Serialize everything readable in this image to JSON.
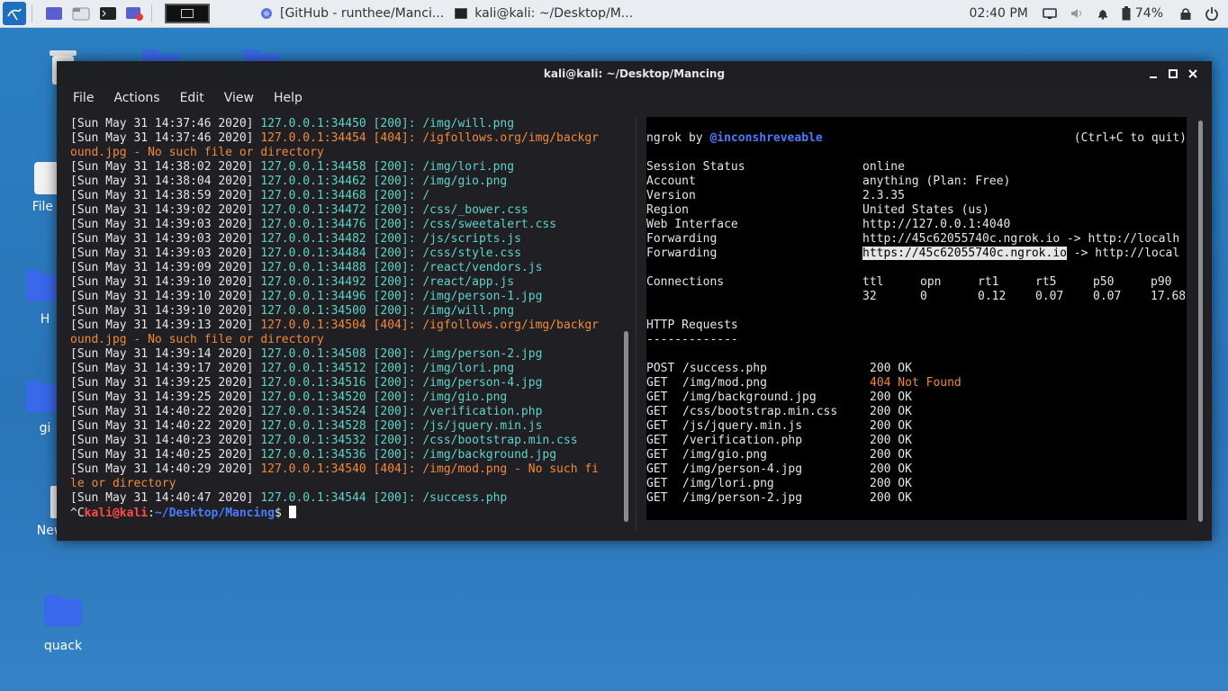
{
  "taskbar": {
    "tasks": [
      {
        "label": "[GitHub - runthee/Manci..."
      },
      {
        "label": "kali@kali: ~/Desktop/M..."
      }
    ],
    "clock": "02:40 PM",
    "battery": "74%"
  },
  "desktop": {
    "icons": [
      {
        "label": "Tr"
      },
      {
        "label": "File S"
      },
      {
        "label": "H"
      },
      {
        "label": "gi"
      },
      {
        "label": "New File"
      },
      {
        "label": "quack"
      }
    ]
  },
  "window": {
    "title": "kali@kali: ~/Desktop/Mancing",
    "menu": [
      "File",
      "Actions",
      "Edit",
      "View",
      "Help"
    ]
  },
  "left_pane": {
    "lines": [
      {
        "t": "[Sun May 31 14:37:46 2020] ",
        "c": "127.0.0.1:34450 [200]: /img/will.png",
        "k": "g"
      },
      {
        "t": "[Sun May 31 14:37:46 2020] ",
        "c": "127.0.0.1:34454 [404]: /igfollows.org/img/backgr",
        "k": "o"
      },
      {
        "t": "",
        "c": "ound.jpg - No such file or directory",
        "k": "o"
      },
      {
        "t": "[Sun May 31 14:38:02 2020] ",
        "c": "127.0.0.1:34458 [200]: /img/lori.png",
        "k": "g"
      },
      {
        "t": "[Sun May 31 14:38:04 2020] ",
        "c": "127.0.0.1:34462 [200]: /img/gio.png",
        "k": "g"
      },
      {
        "t": "[Sun May 31 14:38:59 2020] ",
        "c": "127.0.0.1:34468 [200]: /",
        "k": "g"
      },
      {
        "t": "[Sun May 31 14:39:02 2020] ",
        "c": "127.0.0.1:34472 [200]: /css/_bower.css",
        "k": "g"
      },
      {
        "t": "[Sun May 31 14:39:03 2020] ",
        "c": "127.0.0.1:34476 [200]: /css/sweetalert.css",
        "k": "g"
      },
      {
        "t": "[Sun May 31 14:39:03 2020] ",
        "c": "127.0.0.1:34482 [200]: /js/scripts.js",
        "k": "g"
      },
      {
        "t": "[Sun May 31 14:39:03 2020] ",
        "c": "127.0.0.1:34484 [200]: /css/style.css",
        "k": "g"
      },
      {
        "t": "[Sun May 31 14:39:09 2020] ",
        "c": "127.0.0.1:34488 [200]: /react/vendors.js",
        "k": "g"
      },
      {
        "t": "[Sun May 31 14:39:10 2020] ",
        "c": "127.0.0.1:34492 [200]: /react/app.js",
        "k": "g"
      },
      {
        "t": "[Sun May 31 14:39:10 2020] ",
        "c": "127.0.0.1:34496 [200]: /img/person-1.jpg",
        "k": "g"
      },
      {
        "t": "[Sun May 31 14:39:10 2020] ",
        "c": "127.0.0.1:34500 [200]: /img/will.png",
        "k": "g"
      },
      {
        "t": "[Sun May 31 14:39:13 2020] ",
        "c": "127.0.0.1:34504 [404]: /igfollows.org/img/backgr",
        "k": "o"
      },
      {
        "t": "",
        "c": "ound.jpg - No such file or directory",
        "k": "o"
      },
      {
        "t": "[Sun May 31 14:39:14 2020] ",
        "c": "127.0.0.1:34508 [200]: /img/person-2.jpg",
        "k": "g"
      },
      {
        "t": "[Sun May 31 14:39:17 2020] ",
        "c": "127.0.0.1:34512 [200]: /img/lori.png",
        "k": "g"
      },
      {
        "t": "[Sun May 31 14:39:25 2020] ",
        "c": "127.0.0.1:34516 [200]: /img/person-4.jpg",
        "k": "g"
      },
      {
        "t": "[Sun May 31 14:39:25 2020] ",
        "c": "127.0.0.1:34520 [200]: /img/gio.png",
        "k": "g"
      },
      {
        "t": "[Sun May 31 14:40:22 2020] ",
        "c": "127.0.0.1:34524 [200]: /verification.php",
        "k": "g"
      },
      {
        "t": "[Sun May 31 14:40:22 2020] ",
        "c": "127.0.0.1:34528 [200]: /js/jquery.min.js",
        "k": "g"
      },
      {
        "t": "[Sun May 31 14:40:23 2020] ",
        "c": "127.0.0.1:34532 [200]: /css/bootstrap.min.css",
        "k": "g"
      },
      {
        "t": "[Sun May 31 14:40:25 2020] ",
        "c": "127.0.0.1:34536 [200]: /img/background.jpg",
        "k": "g"
      },
      {
        "t": "[Sun May 31 14:40:29 2020] ",
        "c": "127.0.0.1:34540 [404]: /img/mod.png - No such fi",
        "k": "o"
      },
      {
        "t": "",
        "c": "le or directory",
        "k": "o"
      },
      {
        "t": "[Sun May 31 14:40:47 2020] ",
        "c": "127.0.0.1:34544 [200]: /success.php",
        "k": "g"
      }
    ],
    "prompt_prefix": "^C",
    "prompt_user": "kali@kali",
    "prompt_colon": ":",
    "prompt_path": "~/Desktop/Mancing",
    "prompt_dollar": "$ "
  },
  "right_pane": {
    "header_left": "ngrok by ",
    "header_author": "@inconshreveable",
    "header_right": "(Ctrl+C to quit)",
    "status": [
      {
        "k": "Session Status",
        "v": "online"
      },
      {
        "k": "Account",
        "v": "anything (Plan: Free)"
      },
      {
        "k": "Version",
        "v": "2.3.35"
      },
      {
        "k": "Region",
        "v": "United States (us)"
      },
      {
        "k": "Web Interface",
        "v": "http://127.0.0.1:4040"
      },
      {
        "k": "Forwarding",
        "v": "http://45c62055740c.ngrok.io -> http://localh"
      }
    ],
    "forwarding2_label": "Forwarding",
    "forwarding2_url": "https://45c62055740c.ngrok.io",
    "forwarding2_rest": " -> http://local",
    "connections_label": "Connections",
    "connections_headers": [
      "ttl",
      "opn",
      "rt1",
      "rt5",
      "p50",
      "p90"
    ],
    "connections_values": [
      "32",
      "0",
      "0.12",
      "0.07",
      "0.07",
      "17.68"
    ],
    "http_title": "HTTP Requests",
    "http_rule": "-------------",
    "requests": [
      {
        "m": "POST",
        "p": "/success.php",
        "s": "200 OK",
        "err": false
      },
      {
        "m": "GET ",
        "p": "/img/mod.png",
        "s": "404 Not Found",
        "err": true
      },
      {
        "m": "GET ",
        "p": "/img/background.jpg",
        "s": "200 OK",
        "err": false
      },
      {
        "m": "GET ",
        "p": "/css/bootstrap.min.css",
        "s": "200 OK",
        "err": false
      },
      {
        "m": "GET ",
        "p": "/js/jquery.min.js",
        "s": "200 OK",
        "err": false
      },
      {
        "m": "GET ",
        "p": "/verification.php",
        "s": "200 OK",
        "err": false
      },
      {
        "m": "GET ",
        "p": "/img/gio.png",
        "s": "200 OK",
        "err": false
      },
      {
        "m": "GET ",
        "p": "/img/person-4.jpg",
        "s": "200 OK",
        "err": false
      },
      {
        "m": "GET ",
        "p": "/img/lori.png",
        "s": "200 OK",
        "err": false
      },
      {
        "m": "GET ",
        "p": "/img/person-2.jpg",
        "s": "200 OK",
        "err": false
      }
    ]
  }
}
